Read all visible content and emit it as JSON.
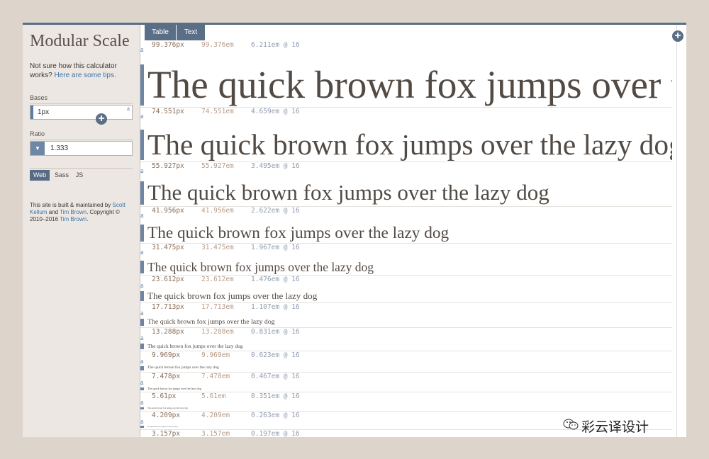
{
  "sidebar": {
    "title": "Modular Scale",
    "help_text": "Not sure how this calculator works?",
    "help_link": "Here are some tips.",
    "bases_label": "Bases",
    "bases_value": "1px",
    "ratio_label": "Ratio",
    "ratio_value": "1.333",
    "formats": [
      "Web",
      "Sass",
      "JS"
    ],
    "footer": {
      "prefix": "This site is built & maintained by",
      "author1": "Scott Kellum",
      "and": "and",
      "author2": "Tim Brown",
      "copyright": ". Copyright © 2010–2016",
      "author3": "Tim Brown",
      "end": "."
    }
  },
  "tabs": [
    "Table",
    "Text"
  ],
  "sample_text": "The quick brown fox jumps over the lazy dog",
  "rows": [
    {
      "px": "99.376px",
      "em": "99.376em",
      "rem": "6.211em @ 16",
      "size": 99.376
    },
    {
      "px": "74.551px",
      "em": "74.551em",
      "rem": "4.659em @ 16",
      "size": 74.551
    },
    {
      "px": "55.927px",
      "em": "55.927em",
      "rem": "3.495em @ 16",
      "size": 55.927
    },
    {
      "px": "41.956px",
      "em": "41.956em",
      "rem": "2.622em @ 16",
      "size": 41.956
    },
    {
      "px": "31.475px",
      "em": "31.475em",
      "rem": "1.967em @ 16",
      "size": 31.475
    },
    {
      "px": "23.612px",
      "em": "23.612em",
      "rem": "1.476em @ 16",
      "size": 23.612
    },
    {
      "px": "17.713px",
      "em": "17.713em",
      "rem": "1.107em @ 16",
      "size": 17.713
    },
    {
      "px": "13.288px",
      "em": "13.288em",
      "rem": "0.831em @ 16",
      "size": 13.288
    },
    {
      "px": "9.969px",
      "em": "9.969em",
      "rem": "0.623em @ 16",
      "size": 9.969
    },
    {
      "px": "7.478px",
      "em": "7.478em",
      "rem": "0.467em @ 16",
      "size": 7.478
    },
    {
      "px": "5.61px",
      "em": "5.61em",
      "rem": "0.351em @ 16",
      "size": 5.61
    },
    {
      "px": "4.209px",
      "em": "4.209em",
      "rem": "0.263em @ 16",
      "size": 4.209
    },
    {
      "px": "3.157px",
      "em": "3.157em",
      "rem": "0.197em @ 16",
      "size": 3.157
    }
  ],
  "watermark": "彩云译设计"
}
